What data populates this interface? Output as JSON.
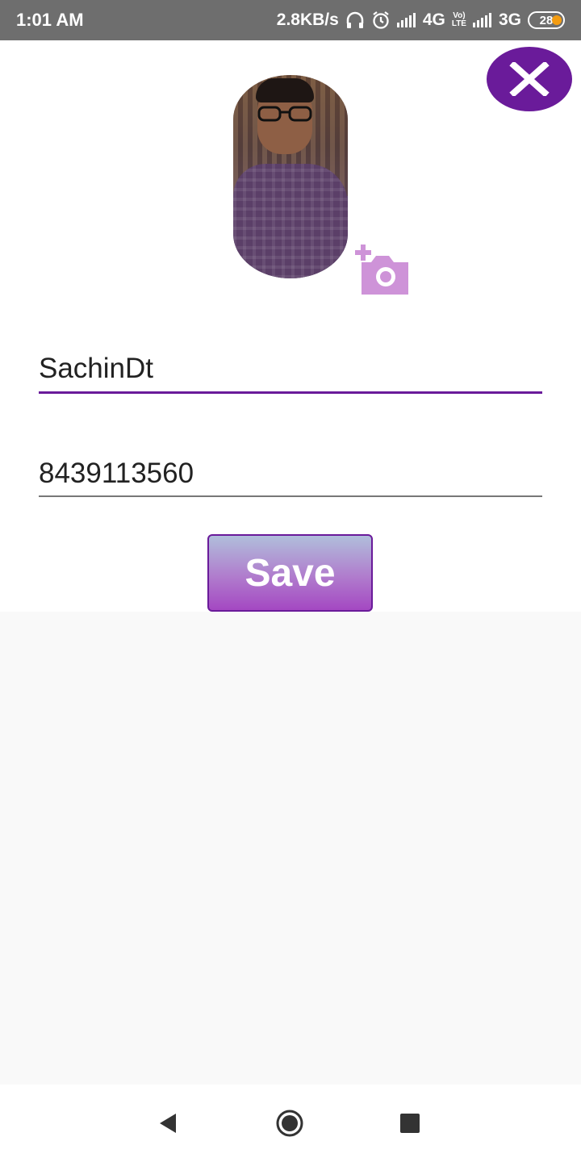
{
  "status_bar": {
    "time": "1:01 AM",
    "net_speed": "2.8KB/s",
    "network_1": "4G",
    "volte_top": "Vo)",
    "volte_bottom": "LTE",
    "network_2": "3G",
    "battery": "28",
    "icons": [
      "headset-icon",
      "alarm-icon",
      "signal-icon",
      "signal-icon"
    ]
  },
  "profile": {
    "name_value": "SachinDt",
    "phone_value": "8439113560",
    "save_label": "Save"
  },
  "colors": {
    "accent": "#6a1b9a",
    "camera": "#ce93d8",
    "status_bar": "#6e6e6e"
  }
}
